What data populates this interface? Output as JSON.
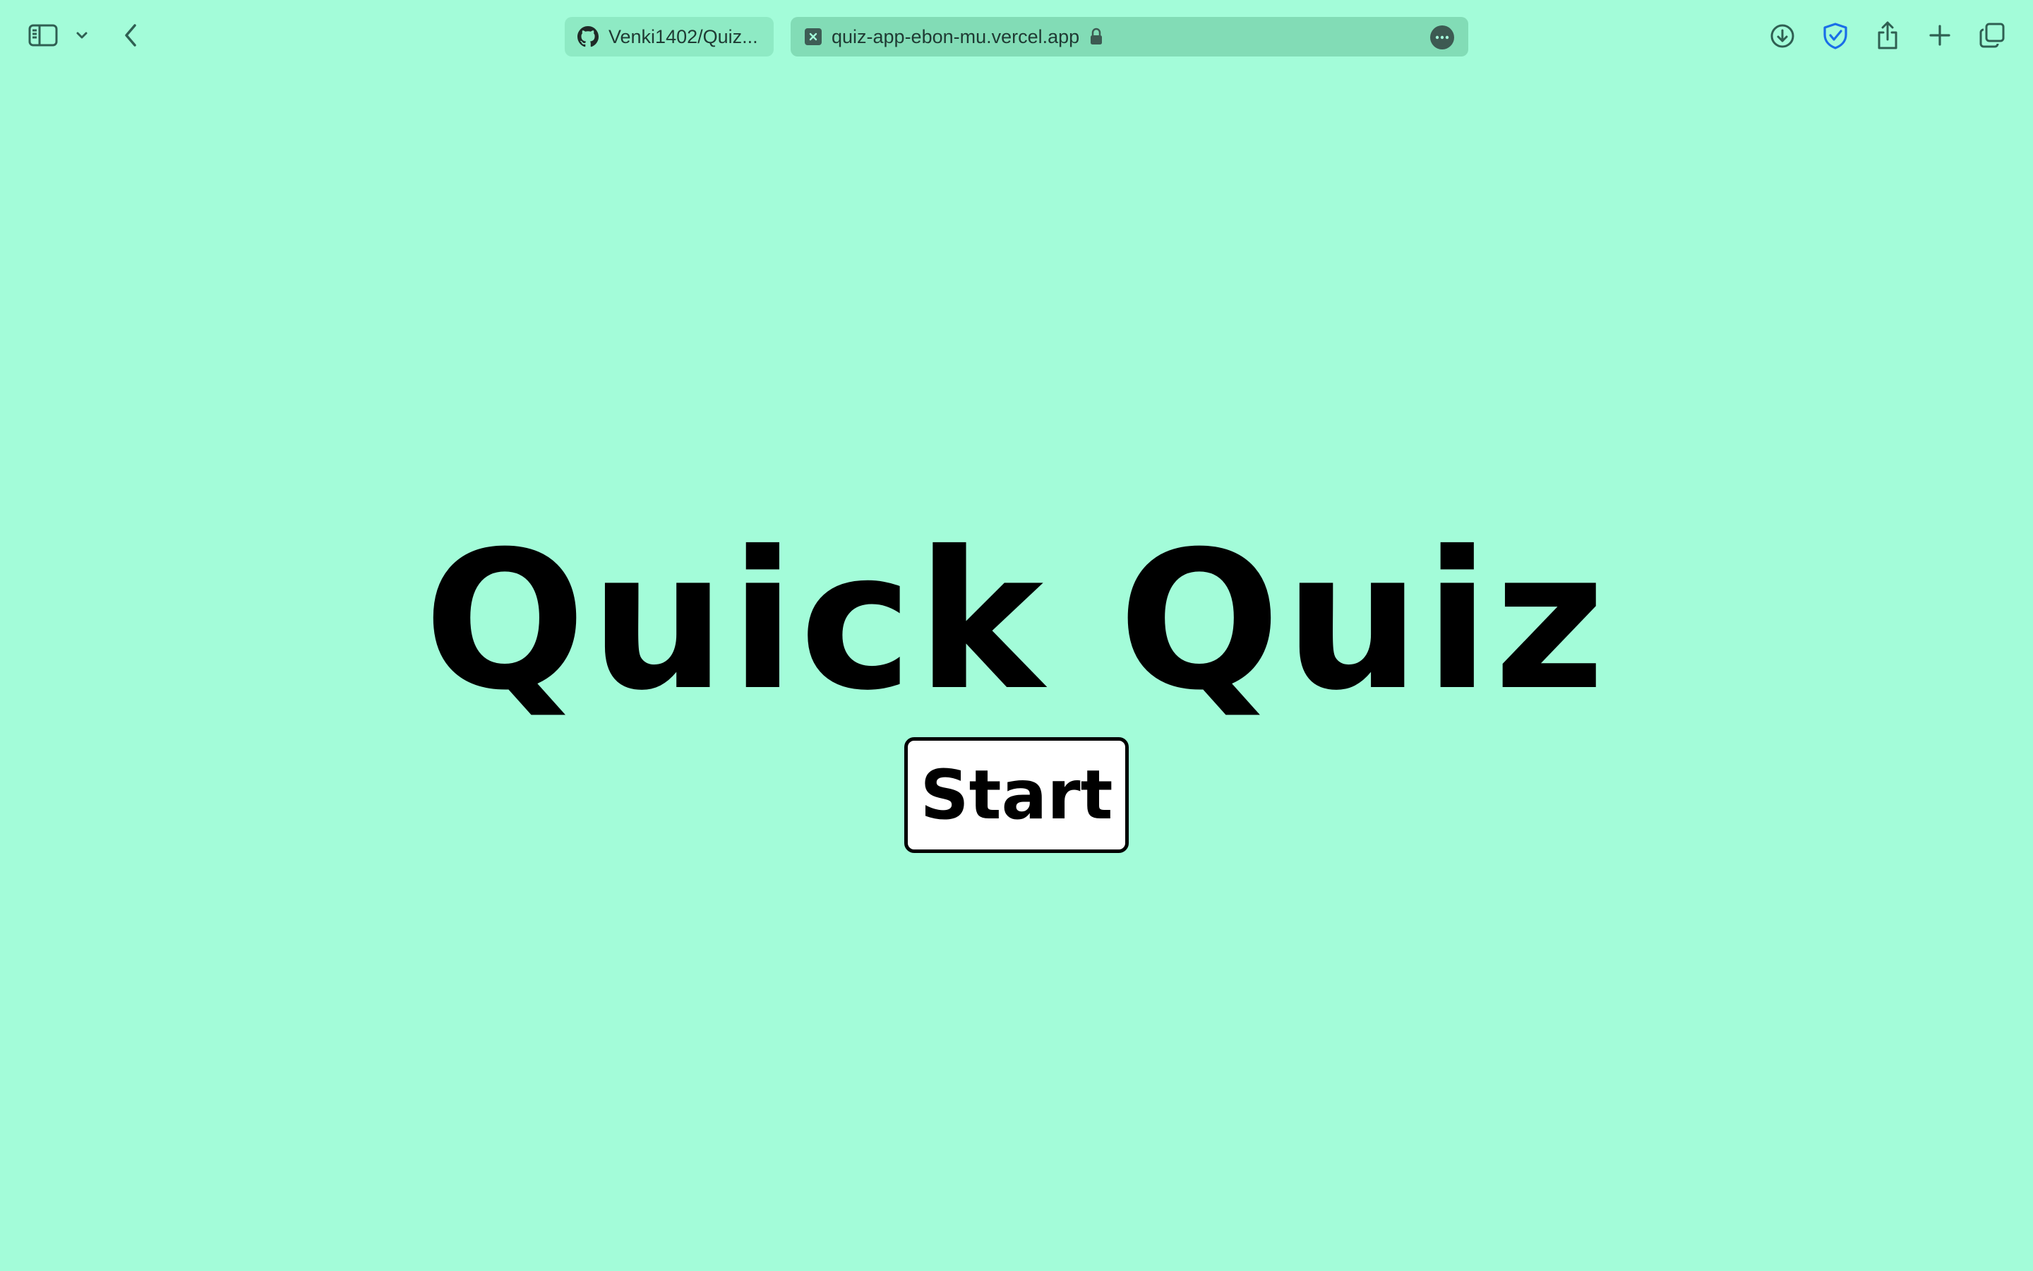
{
  "browser": {
    "tabs": [
      {
        "label": "Venki1402/Quiz...",
        "favicon": "github-icon",
        "active": false
      },
      {
        "label": "quiz-app-ebon-mu.vercel.app",
        "favicon": "site-x-icon",
        "active": true
      }
    ],
    "toolbar_icons": [
      "sidebar-icon",
      "chevron-down-icon",
      "back-icon",
      "download-icon",
      "shield-check-icon",
      "share-icon",
      "plus-icon",
      "tabs-overview-icon"
    ]
  },
  "page": {
    "title": "Quick Quiz",
    "start_label": "Start"
  },
  "colors": {
    "background": "#a3fcd9",
    "shield_accent": "#1a6ee8",
    "button_bg": "#ffffff",
    "text": "#000000"
  }
}
